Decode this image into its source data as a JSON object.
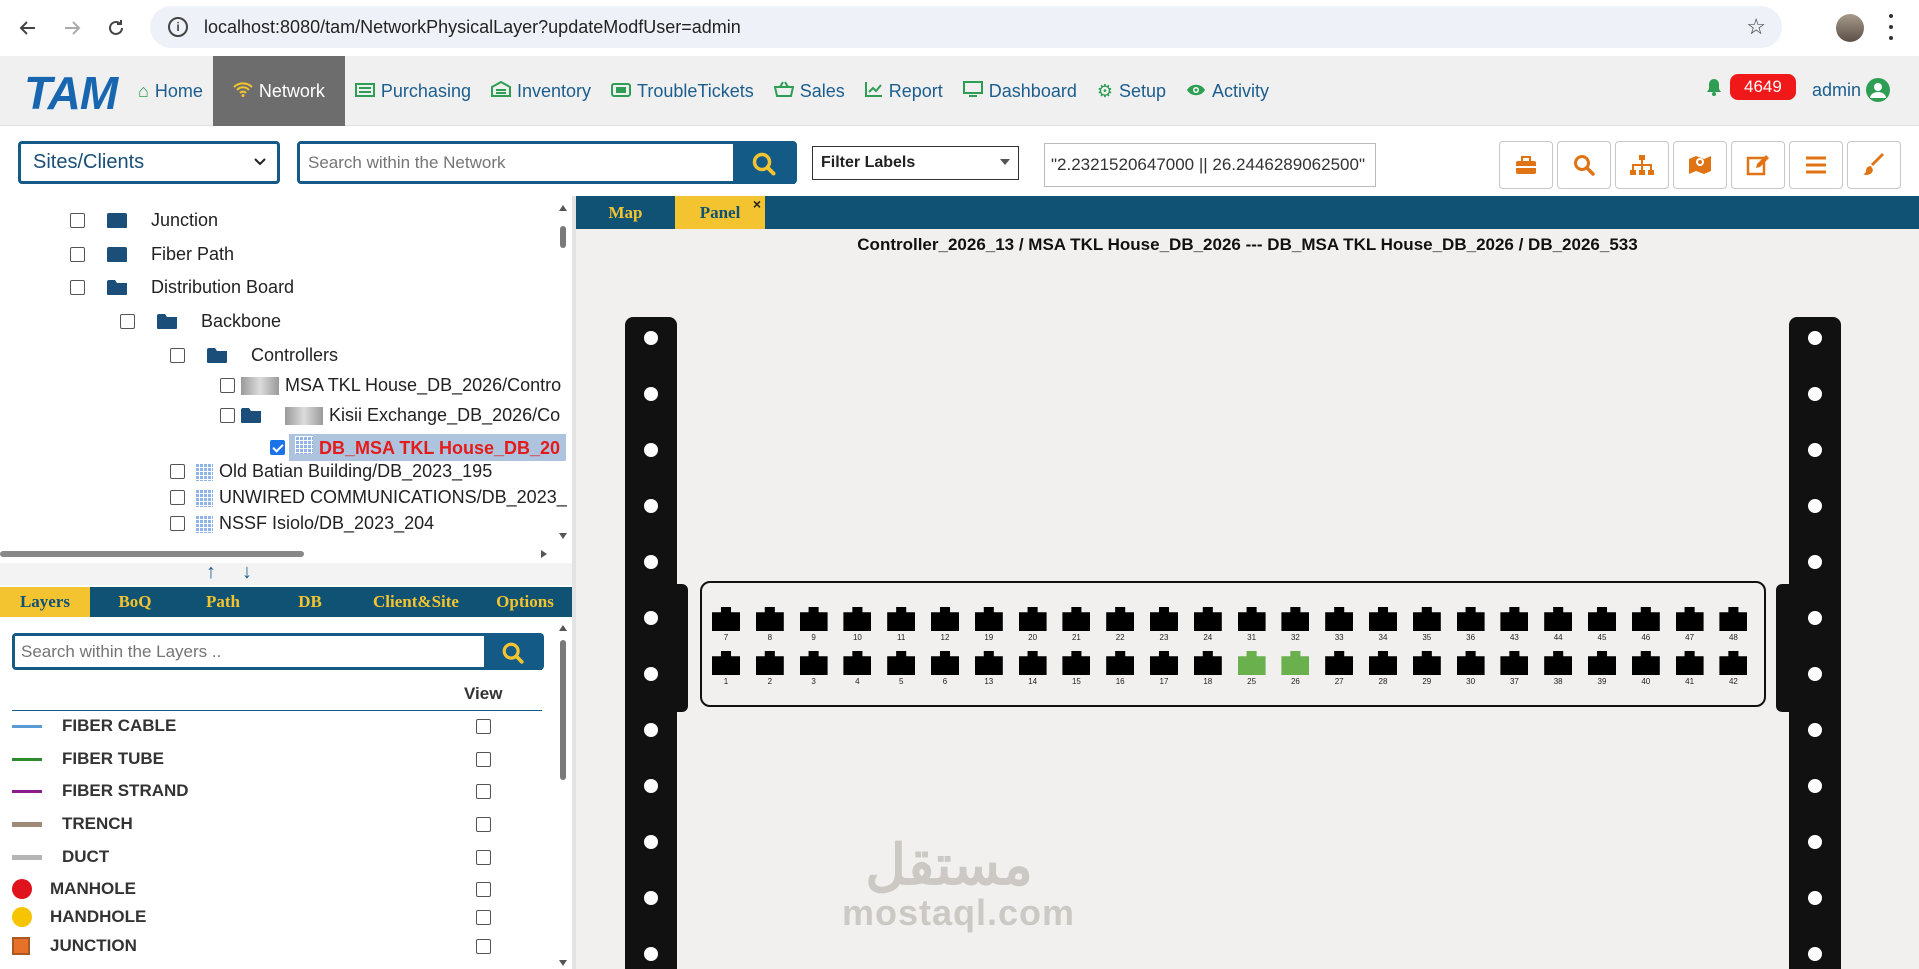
{
  "browser": {
    "url": "localhost:8080/tam/NetworkPhysicalLayer?updateModfUser=admin"
  },
  "app": {
    "logo": "TAM",
    "menu": [
      {
        "label": "Home",
        "icon": "home-icon"
      },
      {
        "label": "Network",
        "icon": "wifi-icon"
      },
      {
        "label": "Purchasing",
        "icon": "purchasing-icon"
      },
      {
        "label": "Inventory",
        "icon": "warehouse-icon"
      },
      {
        "label": "TroubleTickets",
        "icon": "ticket-icon"
      },
      {
        "label": "Sales",
        "icon": "basket-icon"
      },
      {
        "label": "Report",
        "icon": "chart-line-icon"
      },
      {
        "label": "Dashboard",
        "icon": "monitor-icon"
      },
      {
        "label": "Setup",
        "icon": "gear-icon"
      },
      {
        "label": "Activity",
        "icon": "eye-icon"
      }
    ],
    "active_menu": "Network",
    "notifications": "4649",
    "user": "admin",
    "colors": {
      "primary": "#145a86",
      "accent": "#f4c430",
      "menu_text": "#1b5e8e",
      "icon_green": "#2e9e55",
      "tool_orange": "#e07314",
      "badge_red": "#f01818"
    }
  },
  "toolbar": {
    "scope_select": "Sites/Clients",
    "search_placeholder": "Search within the Network",
    "filter_labels": "Filter Labels",
    "coordinates": "\"2.2321520647000 || 26.2446289062500\"",
    "tools": [
      "toolbox-icon",
      "search-icon",
      "hierarchy-icon",
      "map-marker-icon",
      "edit-icon",
      "list-icon",
      "brush-icon"
    ]
  },
  "tree": {
    "items": [
      {
        "label": "Junction"
      },
      {
        "label": "Fiber Path"
      },
      {
        "label": "Distribution Board"
      },
      {
        "label": "Backbone"
      },
      {
        "label": "Controllers"
      },
      {
        "label": "MSA TKL House_DB_2026/Contro"
      },
      {
        "label": "Kisii Exchange_DB_2026/Co"
      },
      {
        "label": "DB_MSA TKL House_DB_20"
      },
      {
        "label": "Old Batian Building/DB_2023_195"
      },
      {
        "label": "UNWIRED COMMUNICATIONS/DB_2023_"
      },
      {
        "label": "NSSF Isiolo/DB_2023_204"
      }
    ]
  },
  "bottom_tabs": [
    "Layers",
    "BoQ",
    "Path",
    "DB",
    "Client&Site",
    "Options"
  ],
  "layers": {
    "search_placeholder": "Search within the Layers ..",
    "view_header": "View",
    "items": [
      {
        "name": "FIBER CABLE",
        "color": "#5b9bd5"
      },
      {
        "name": "FIBER TUBE",
        "color": "#2e8b2e"
      },
      {
        "name": "FIBER STRAND",
        "color": "#8b1a8b"
      },
      {
        "name": "TRENCH",
        "color": "#a08a78"
      },
      {
        "name": "DUCT",
        "color": "#b5b5b5"
      },
      {
        "name": "MANHOLE",
        "color": "#e0121b"
      },
      {
        "name": "HANDHOLE",
        "color": "#f6c400"
      },
      {
        "name": "JUNCTION",
        "color": "#e8712a"
      }
    ]
  },
  "panel": {
    "tabs": [
      "Map",
      "Panel"
    ],
    "active_tab": "Panel",
    "close_symbol": "×",
    "title": "Controller_2026_13 / MSA TKL House_DB_2026 --- DB_MSA TKL House_DB_2026 / DB_2026_533",
    "top_ports": [
      7,
      8,
      9,
      10,
      11,
      12,
      19,
      20,
      21,
      22,
      23,
      24,
      31,
      32,
      33,
      34,
      35,
      36,
      43,
      44,
      45,
      46,
      47,
      48
    ],
    "bottom_ports": [
      1,
      2,
      3,
      4,
      5,
      6,
      13,
      14,
      15,
      16,
      17,
      18,
      25,
      26,
      27,
      28,
      29,
      30,
      37,
      38,
      39,
      40,
      41,
      42
    ],
    "active_ports": [
      25,
      26
    ],
    "port_color": "#000000",
    "active_port_color": "#6ab04c"
  },
  "watermark": {
    "arabic": "مستقل",
    "latin": "mostaql.com"
  }
}
